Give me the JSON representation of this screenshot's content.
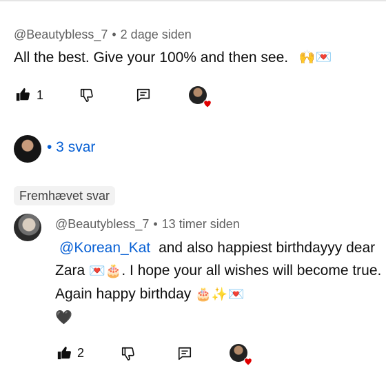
{
  "comment": {
    "author": "@Beautybless_7",
    "separator": "•",
    "time": "2 dage siden",
    "text": "All the best.  Give your 100% and then see.",
    "emojis": "🙌💌",
    "likes": "1"
  },
  "replies": {
    "label": "• 3 svar"
  },
  "featured_label": "Fremhævet svar",
  "reply": {
    "author": "@Beautybless_7",
    "separator": "•",
    "time": "13 timer siden",
    "mention": "@Korean_Kat",
    "text_a": "and also happiest birthdayyy dear Zara",
    "emojis_a": "💌🎂",
    "text_b": ". I hope your all wishes will become true. Again happy birthday",
    "emojis_b": "🎂✨💌",
    "emojis_c": "🖤",
    "likes": "2"
  },
  "icons": {
    "like": "thumbs-up-icon",
    "dislike": "thumbs-down-icon",
    "reply": "comment-icon",
    "creator": "creator-heart-icon"
  },
  "colors": {
    "link": "#065fd4",
    "meta": "#606060",
    "heart": "#e00000",
    "chip_bg": "#f2f2f2"
  }
}
